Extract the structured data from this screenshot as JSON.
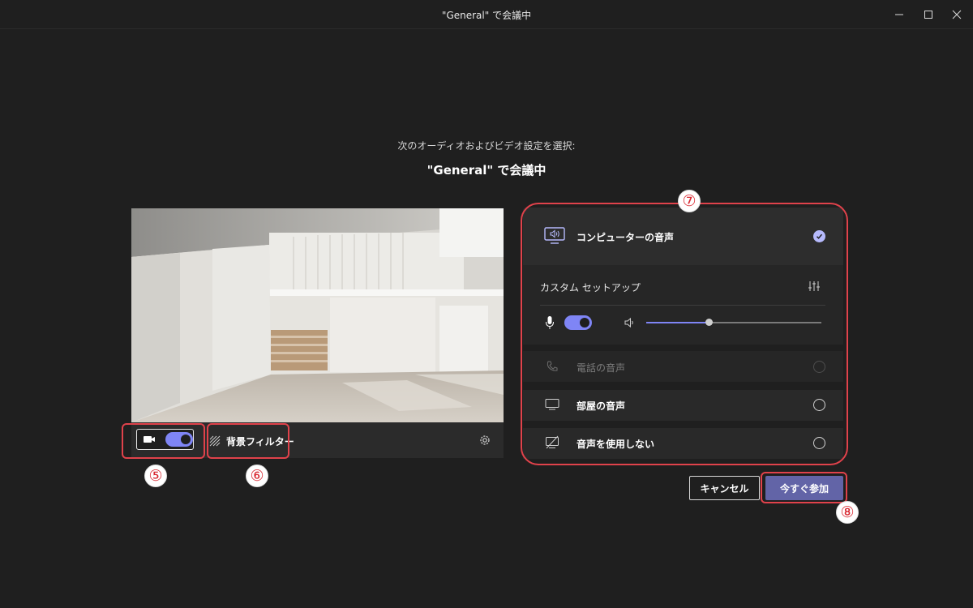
{
  "window": {
    "title": "\"General\" で会議中"
  },
  "prejoin": {
    "subtitle": "次のオーディオおよびビデオ設定を選択:",
    "meeting_title": "\"General\" で会議中"
  },
  "video": {
    "camera_on": true,
    "background_filter_label": "背景フィルター"
  },
  "audio": {
    "computer_audio_label": "コンピューターの音声",
    "computer_audio_selected": true,
    "custom_setup_label": "カスタム セットアップ",
    "mic_on": true,
    "speaker_volume": 0.36,
    "phone_audio_label": "電話の音声",
    "room_audio_label": "部屋の音声",
    "no_audio_label": "音声を使用しない"
  },
  "actions": {
    "cancel_label": "キャンセル",
    "join_label": "今すぐ参加"
  },
  "annotations": {
    "badge_5": "⑤",
    "badge_6": "⑥",
    "badge_7": "⑦",
    "badge_8": "⑧",
    "highlight_color": "#e0424b"
  },
  "colors": {
    "background": "#1f1f1f",
    "accent": "#7f85f5",
    "primary_button": "#6264a7"
  }
}
